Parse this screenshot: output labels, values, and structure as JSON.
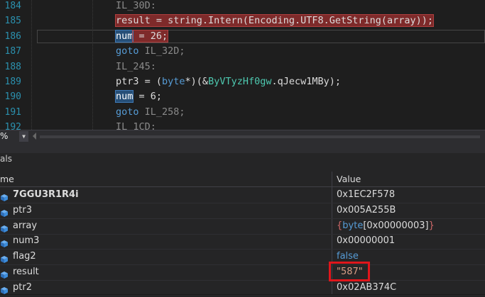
{
  "editor": {
    "lines": [
      {
        "number": "184",
        "tokens": [
          {
            "t": "IL_30D:",
            "c": "lbl"
          }
        ]
      },
      {
        "number": "185",
        "tokens": [
          {
            "t": "result = string.Intern(Encoding.UTF8.GetString(array));",
            "c": "ident",
            "hl": "red"
          }
        ]
      },
      {
        "number": "186",
        "tokens": [
          {
            "t": "num",
            "c": "ident",
            "hl": "ref"
          },
          {
            "t": " = 26;",
            "c": "ident",
            "hl": "red"
          }
        ]
      },
      {
        "number": "187",
        "tokens": [
          {
            "t": "goto",
            "c": "kw"
          },
          {
            "t": " IL_32D;",
            "c": "lbl"
          }
        ]
      },
      {
        "number": "188",
        "tokens": [
          {
            "t": "IL_245:",
            "c": "lbl"
          }
        ]
      },
      {
        "number": "189",
        "tokens": [
          {
            "t": "ptr3 = (",
            "c": "ident"
          },
          {
            "t": "byte",
            "c": "kw"
          },
          {
            "t": "*)(&",
            "c": "ident"
          },
          {
            "t": "ByVTyzHf0gw",
            "c": "obf"
          },
          {
            "t": ".qJecw1MBy);",
            "c": "ident"
          }
        ]
      },
      {
        "number": "190",
        "tokens": [
          {
            "t": "num",
            "c": "ident",
            "hl": "ref"
          },
          {
            "t": " = 6;",
            "c": "ident"
          }
        ]
      },
      {
        "number": "191",
        "tokens": [
          {
            "t": "goto",
            "c": "kw"
          },
          {
            "t": " IL_258;",
            "c": "lbl"
          }
        ]
      },
      {
        "number": "192",
        "tokens": [
          {
            "t": "IL_1CD:",
            "c": "lbl"
          }
        ]
      }
    ]
  },
  "zoom": {
    "value": "%",
    "dropdown_glyph": "▼"
  },
  "locals": {
    "title": "als",
    "columns": {
      "name": "me",
      "value": "Value"
    },
    "rows": [
      {
        "name": "7GGU3R1R4i",
        "bold": true,
        "value": [
          {
            "t": "0x1EC2F578",
            "c": ""
          }
        ]
      },
      {
        "name": "ptr3",
        "bold": false,
        "value": [
          {
            "t": "0x005A255B",
            "c": ""
          }
        ]
      },
      {
        "name": "array",
        "bold": false,
        "value": [
          {
            "t": "{",
            "c": "brace"
          },
          {
            "t": "byte",
            "c": "kwv"
          },
          {
            "t": "[0x00000003]",
            "c": ""
          },
          {
            "t": "}",
            "c": "brace"
          }
        ]
      },
      {
        "name": "num3",
        "bold": false,
        "value": [
          {
            "t": "0x00000001",
            "c": ""
          }
        ]
      },
      {
        "name": "flag2",
        "bold": false,
        "value": [
          {
            "t": "false",
            "c": "kwv"
          }
        ]
      },
      {
        "name": "result",
        "bold": false,
        "value": [
          {
            "t": "\"587\"",
            "c": "str"
          }
        ]
      },
      {
        "name": "ptr2",
        "bold": false,
        "value": [
          {
            "t": "0x02AB374C",
            "c": ""
          }
        ]
      }
    ]
  },
  "colors": {
    "highlight_box": "#e0161b",
    "icon_blue": "#3c8ddc"
  }
}
